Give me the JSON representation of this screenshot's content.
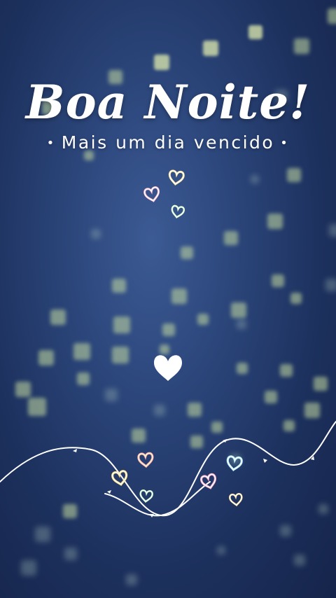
{
  "greeting": {
    "title": "Boa Noite!",
    "subtitle": "Mais um dia vencido",
    "separator": "•"
  },
  "decorations": {
    "hearts_icon": "heart-outline-icon",
    "center_heart_icon": "heart-filled-icon",
    "wave_icon": "wavy-line-with-arrows"
  },
  "colors": {
    "background": "#23396a",
    "text": "#ffffff",
    "bokeh": "#c8dea0"
  }
}
